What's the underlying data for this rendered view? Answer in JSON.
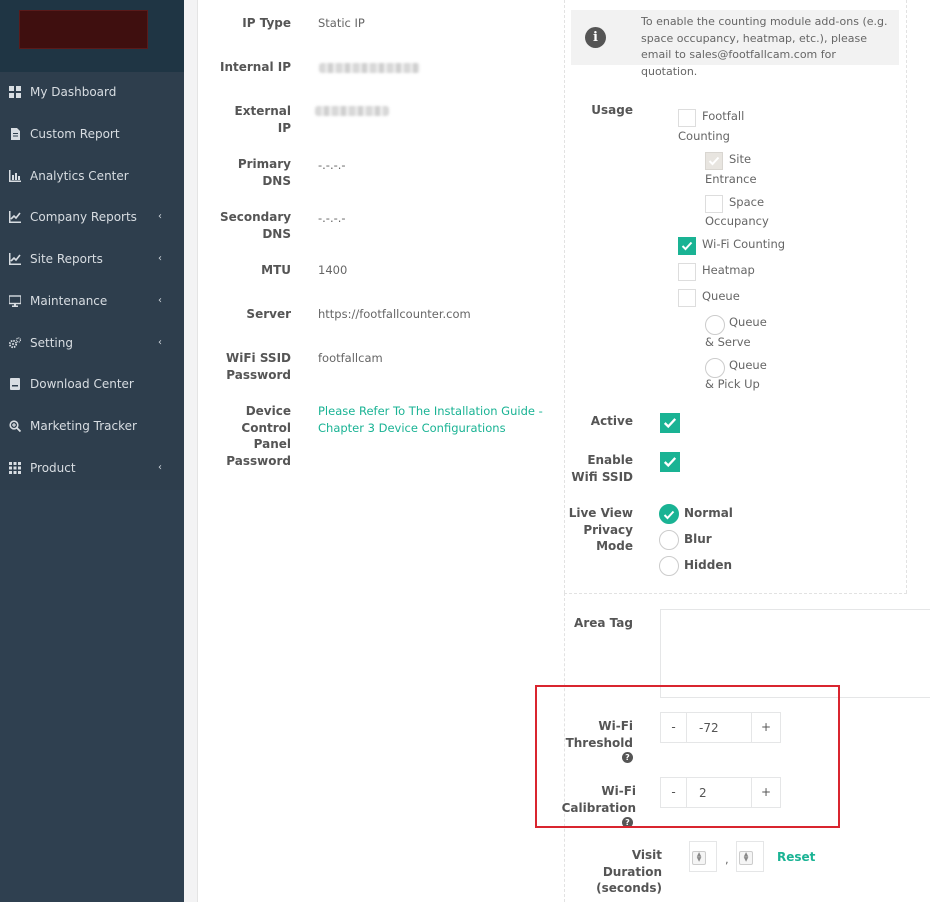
{
  "sidebar": {
    "items": [
      {
        "label": "My Dashboard",
        "icon": "dashboard-icon",
        "chevron": ""
      },
      {
        "label": "Custom Report",
        "icon": "file-icon",
        "chevron": ""
      },
      {
        "label": "Analytics Center",
        "icon": "bar-chart-icon",
        "chevron": ""
      },
      {
        "label": "Company Reports",
        "icon": "line-chart-icon",
        "chevron": "‹"
      },
      {
        "label": "Site Reports",
        "icon": "line-chart-icon",
        "chevron": "‹"
      },
      {
        "label": "Maintenance",
        "icon": "desktop-icon",
        "chevron": "‹"
      },
      {
        "label": "Setting",
        "icon": "cogs-icon",
        "chevron": "‹"
      },
      {
        "label": "Download Center",
        "icon": "download-icon",
        "chevron": ""
      },
      {
        "label": "Marketing Tracker",
        "icon": "search-plus-icon",
        "chevron": ""
      },
      {
        "label": "Product",
        "icon": "grid-icon",
        "chevron": "‹"
      }
    ]
  },
  "network": {
    "ip_type_label": "IP Type",
    "ip_type_value": "Static IP",
    "internal_ip_label": "Internal IP",
    "external_ip_label": "External IP",
    "primary_dns_label": "Primary DNS",
    "primary_dns_value": "-.-.-.-",
    "secondary_dns_label": "Secondary DNS",
    "secondary_dns_value": "-.-.-.-",
    "mtu_label": "MTU",
    "mtu_value": "1400",
    "server_label": "Server",
    "server_value": "https://footfallcounter.com",
    "wifi_ssid_label": "WiFi SSID Password",
    "wifi_ssid_value": "footfallcam",
    "device_cp_label": "Device Control Panel Password",
    "device_cp_link": "Please Refer To The Installation Guide - Chapter 3 Device Configurations"
  },
  "info_text": "To enable the counting module add-ons (e.g. space occupancy, heatmap, etc.), please email to sales@footfallcam.com for quotation.",
  "usage": {
    "label": "Usage",
    "footfall_l1": "Footfall",
    "footfall_l2": "Counting",
    "site_l1": "Site",
    "site_l2": "Entrance",
    "space_l1": "Space",
    "space_l2": "Occupancy",
    "wifi": "Wi-Fi Counting",
    "heatmap": "Heatmap",
    "queue": "Queue",
    "qs_l1": "Queue",
    "qs_l2": "& Serve",
    "qp_l1": "Queue",
    "qp_l2": "& Pick Up"
  },
  "active_label": "Active",
  "enable_wifi_label": "Enable Wifi SSID",
  "privacy": {
    "label": "Live View Privacy Mode",
    "options": [
      "Normal",
      "Blur",
      "Hidden"
    ],
    "selected": "Normal"
  },
  "area_tag_label": "Area Tag",
  "wifi_threshold": {
    "label": "Wi-Fi Threshold",
    "minus": "-",
    "value": "-72",
    "plus": "+"
  },
  "wifi_calibration": {
    "label": "Wi-Fi Calibration",
    "minus": "-",
    "value": "2",
    "plus": "+"
  },
  "visit_duration": {
    "label": "Visit Duration (seconds)",
    "separator": ",",
    "reset": "Reset"
  },
  "colors": {
    "accent": "#1ab394",
    "sidebar": "#2f4050",
    "highlight": "#d9252f"
  }
}
